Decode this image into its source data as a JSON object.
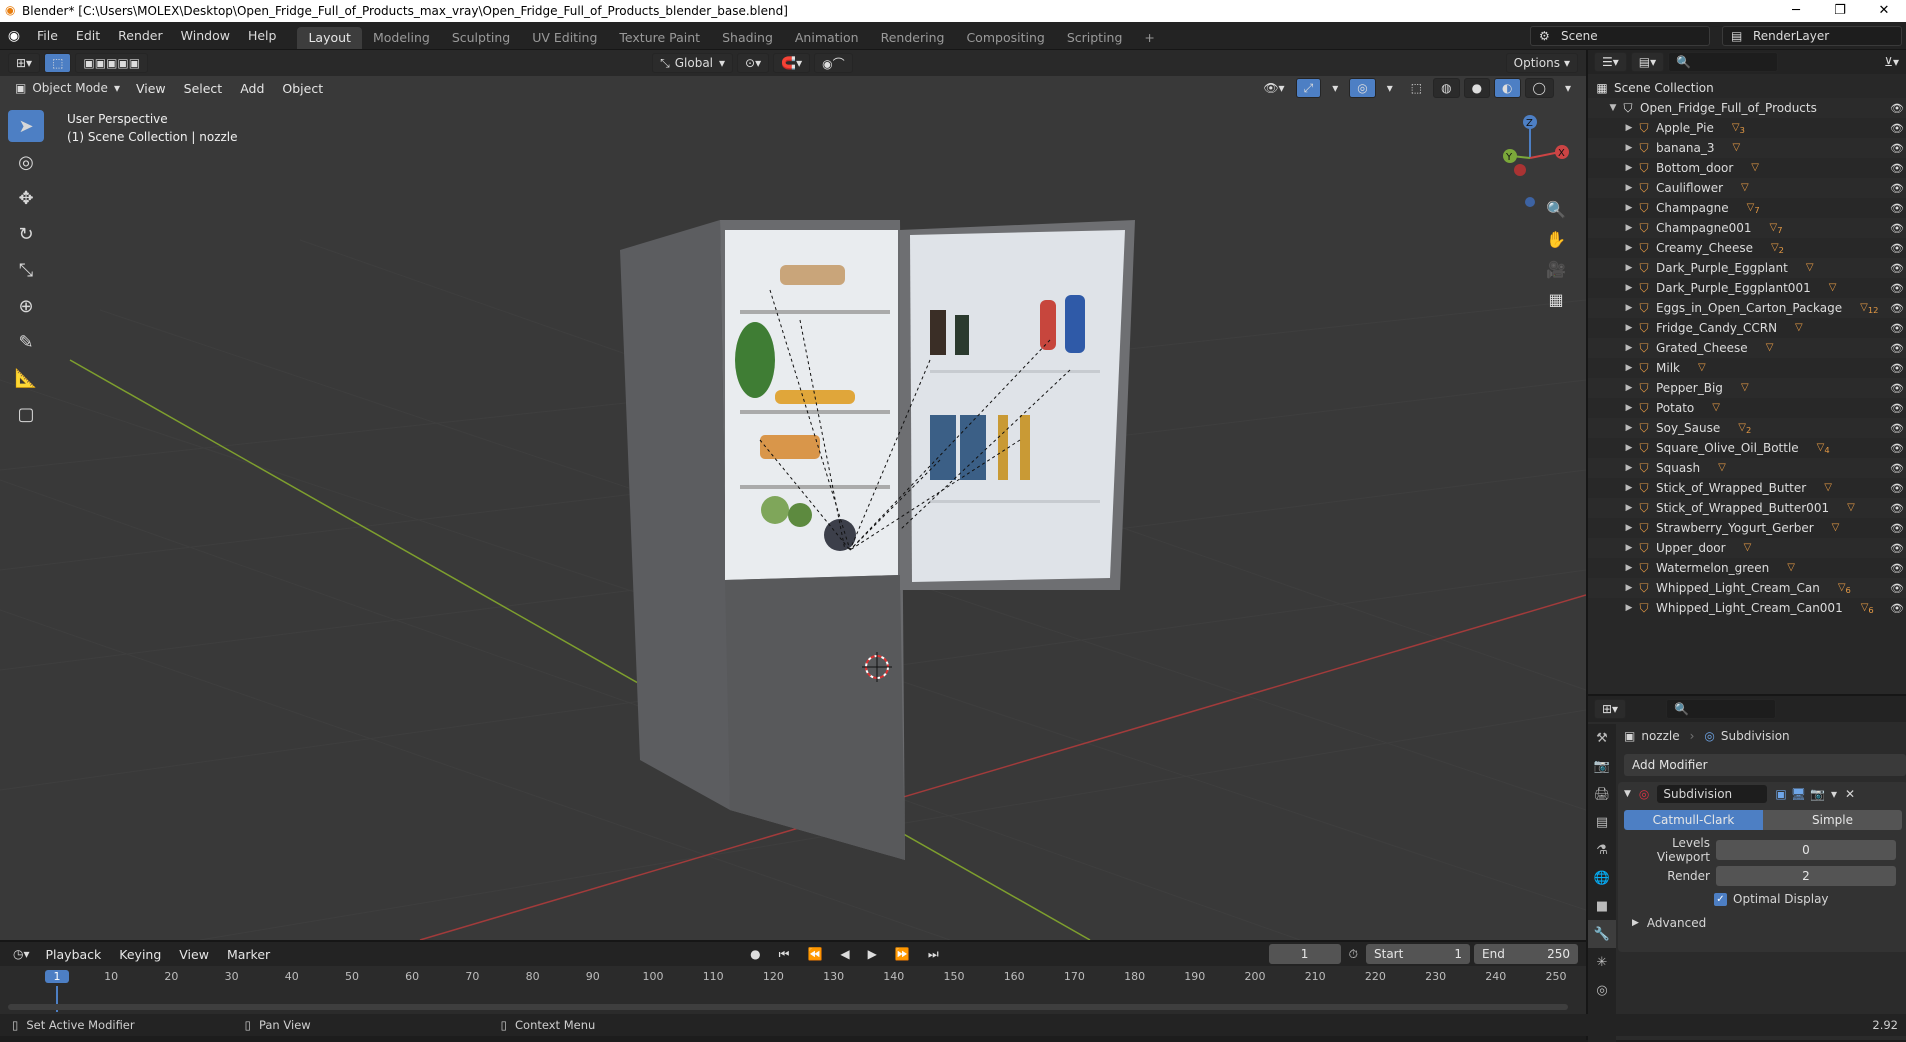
{
  "title_bar": {
    "text": "Blender* [C:\\Users\\MOLEX\\Desktop\\Open_Fridge_Full_of_Products_max_vray\\Open_Fridge_Full_of_Products_blender_base.blend]",
    "minimize": "─",
    "maximize": "❐",
    "close": "✕"
  },
  "top_menu": [
    "File",
    "Edit",
    "Render",
    "Window",
    "Help"
  ],
  "workspace_tabs": [
    "Layout",
    "Modeling",
    "Sculpting",
    "UV Editing",
    "Texture Paint",
    "Shading",
    "Animation",
    "Rendering",
    "Compositing",
    "Scripting"
  ],
  "workspace_add": "+",
  "scene_name": "Scene",
  "render_layer": "RenderLayer",
  "viewport": {
    "mode": "Object Mode",
    "menus": [
      "View",
      "Select",
      "Add",
      "Object"
    ],
    "transform_orientation": "Global",
    "options_label": "Options",
    "info_line1": "User Perspective",
    "info_line2": "(1) Scene Collection | nozzle",
    "gizmo_axes": {
      "z": "Z",
      "y": "Y",
      "x": "X"
    }
  },
  "outliner": {
    "root": "Scene Collection",
    "collection": "Open_Fridge_Full_of_Products",
    "items": [
      {
        "name": "Apple_Pie",
        "badge": "3"
      },
      {
        "name": "banana_3",
        "badge": ""
      },
      {
        "name": "Bottom_door",
        "badge": ""
      },
      {
        "name": "Cauliflower",
        "badge": ""
      },
      {
        "name": "Champagne",
        "badge": "7"
      },
      {
        "name": "Champagne001",
        "badge": "7"
      },
      {
        "name": "Creamy_Cheese",
        "badge": "2"
      },
      {
        "name": "Dark_Purple_Eggplant",
        "badge": ""
      },
      {
        "name": "Dark_Purple_Eggplant001",
        "badge": ""
      },
      {
        "name": "Eggs_in_Open_Carton_Package",
        "badge": "12"
      },
      {
        "name": "Fridge_Candy_CCRN",
        "badge": ""
      },
      {
        "name": "Grated_Cheese",
        "badge": ""
      },
      {
        "name": "Milk",
        "badge": ""
      },
      {
        "name": "Pepper_Big",
        "badge": ""
      },
      {
        "name": "Potato",
        "badge": ""
      },
      {
        "name": "Soy_Sause",
        "badge": "2"
      },
      {
        "name": "Square_Olive_Oil_Bottle",
        "badge": "4"
      },
      {
        "name": "Squash",
        "badge": ""
      },
      {
        "name": "Stick_of_Wrapped_Butter",
        "badge": ""
      },
      {
        "name": "Stick_of_Wrapped_Butter001",
        "badge": ""
      },
      {
        "name": "Strawberry_Yogurt_Gerber",
        "badge": ""
      },
      {
        "name": "Upper_door",
        "badge": ""
      },
      {
        "name": "Watermelon_green",
        "badge": ""
      },
      {
        "name": "Whipped_Light_Cream_Can",
        "badge": "6"
      },
      {
        "name": "Whipped_Light_Cream_Can001",
        "badge": "6"
      }
    ]
  },
  "properties": {
    "object_name": "nozzle",
    "modifier_context": "Subdivision",
    "add_modifier": "Add Modifier",
    "modifier_name": "Subdivision",
    "algo_catmull": "Catmull-Clark",
    "algo_simple": "Simple",
    "levels_viewport_label": "Levels Viewport",
    "levels_viewport_value": "0",
    "render_label": "Render",
    "render_value": "2",
    "optimal_display": "Optimal Display",
    "advanced": "Advanced"
  },
  "timeline": {
    "menus": [
      "Playback",
      "Keying",
      "View",
      "Marker"
    ],
    "current_frame": "1",
    "start_label": "Start",
    "start_value": "1",
    "end_label": "End",
    "end_value": "250",
    "ticks": [
      "1",
      "10",
      "20",
      "30",
      "40",
      "50",
      "60",
      "70",
      "80",
      "90",
      "100",
      "110",
      "120",
      "130",
      "140",
      "150",
      "160",
      "170",
      "180",
      "190",
      "200",
      "210",
      "220",
      "230",
      "240",
      "250"
    ]
  },
  "status_bar": {
    "left": "Set Active Modifier",
    "mid": "Pan View",
    "right": "Context Menu",
    "version": "2.92"
  },
  "colors": {
    "accent": "#4d7fc4",
    "object": "#e59a45",
    "mesh": "#5ec68b",
    "modifier": "#6fa6e8",
    "grid": "#393939"
  }
}
